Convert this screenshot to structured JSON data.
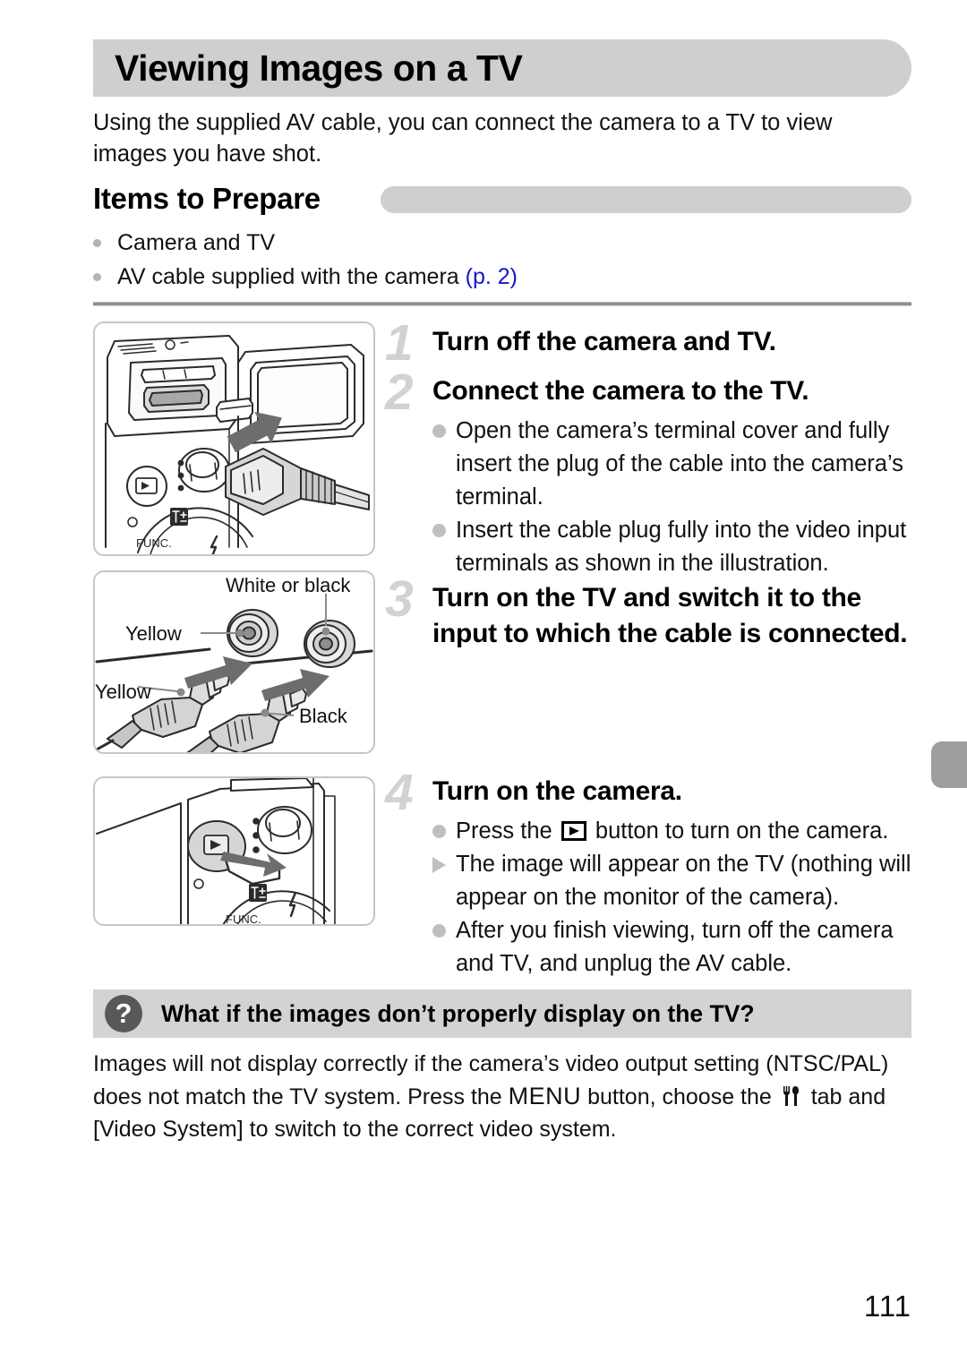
{
  "page": {
    "title": "Viewing Images on a TV",
    "intro": "Using the supplied AV cable, you can connect the camera to a TV to view images you have shot.",
    "page_number": "111"
  },
  "section": {
    "heading": "Items to Prepare",
    "items": [
      {
        "text": "Camera and TV",
        "ref": ""
      },
      {
        "text": "AV cable supplied with the camera ",
        "ref": "(p. 2)"
      }
    ]
  },
  "steps": [
    {
      "number": "1",
      "heading": "Turn off the camera and TV.",
      "bullets": []
    },
    {
      "number": "2",
      "heading": "Connect the camera to the TV.",
      "bullets": [
        {
          "marker": "dot",
          "text": "Open the camera’s terminal cover and fully insert the plug of the cable into the camera’s terminal."
        },
        {
          "marker": "dot",
          "text": "Insert the cable plug fully into the video input terminals as shown in the illustration."
        }
      ]
    },
    {
      "number": "3",
      "heading": "Turn on the TV and switch it to the input to which the cable is connected.",
      "bullets": []
    },
    {
      "number": "4",
      "heading": "Turn on the camera.",
      "bullets": [
        {
          "marker": "dot",
          "text_before": "Press the ",
          "icon": "playback-icon",
          "text_after": " button to turn on the camera."
        },
        {
          "marker": "triangle",
          "text": "The image will appear on the TV (nothing will appear on the monitor of the camera)."
        },
        {
          "marker": "dot",
          "text": "After you finish viewing, turn off the camera and TV, and unplug the AV cable."
        }
      ]
    }
  ],
  "figures": {
    "figure1": {
      "name": "camera-terminal-connect-illustration",
      "labels": []
    },
    "figure2": {
      "name": "rca-jacks-illustration",
      "labels": {
        "white_or_black": "White or black",
        "yellow_jack": "Yellow",
        "yellow_plug": "Yellow",
        "black_plug": "Black"
      }
    },
    "figure3": {
      "name": "camera-playback-button-press-illustration",
      "labels": []
    }
  },
  "faq": {
    "icon": "question-mark-icon",
    "title": "What if the images don’t properly display on the TV?",
    "body_part1": "Images will not display correctly if the camera’s video output setting (NTSC/PAL) does not match the TV system. Press the ",
    "menu_label": "MENU",
    "body_part2": " button, choose the ",
    "tab_icon": "settings-tools-tab-icon",
    "body_part3": " tab and [Video System] to switch to the correct video system."
  },
  "colors": {
    "bar_gray": "#cfcfcf",
    "faq_bar_gray": "#d3d3d3",
    "step_number_gray": "#d2d2d2",
    "link_blue": "#1515d0",
    "edge_tab_gray": "#9e9e9e"
  }
}
